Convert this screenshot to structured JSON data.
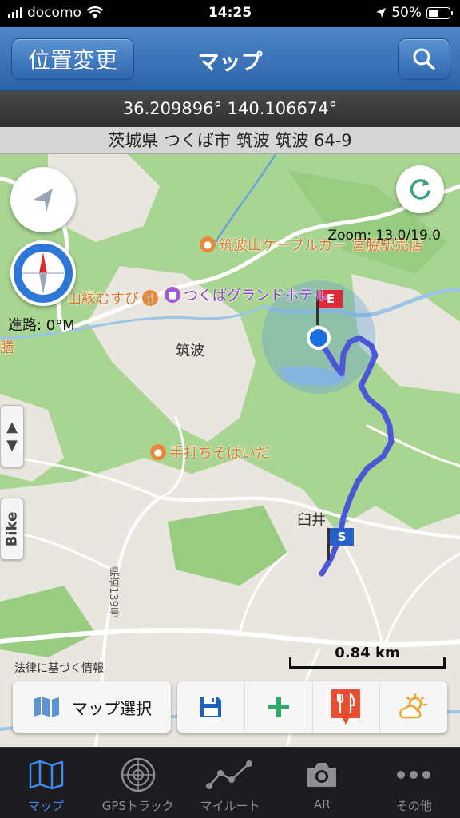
{
  "status_bar": {
    "carrier": "docomo",
    "time": "14:25",
    "battery": "50%",
    "battery_level": 0.5
  },
  "nav": {
    "left_button": "位置変更",
    "title": "マップ",
    "right_icon": "search-icon"
  },
  "location": {
    "coordinates": "36.209896° 140.106674°",
    "address": "茨城県 つくば市 筑波 筑波 64-9"
  },
  "map": {
    "zoom": "Zoom: 13.0/19.0",
    "heading": "進路: 0°M",
    "places": {
      "tsukuba": "筑波",
      "usui": "臼井",
      "route_number": "県道139号"
    },
    "pois": {
      "cable_car": "筑波山ケーブルカー 宮脇駅売店",
      "hotel": "つくばグランドホテル",
      "musubi": "山縁むすび",
      "soba": "手打ちそばいだ",
      "edge": "膳"
    },
    "markers": {
      "end": "E",
      "start": "S"
    },
    "side_tab": "Bike",
    "legal": "法律に基づく情報",
    "scale": "0.84 km"
  },
  "tools": {
    "map_select": "マップ選択"
  },
  "tabs": [
    {
      "label": "マップ",
      "icon": "map-icon",
      "active": true
    },
    {
      "label": "GPSトラック",
      "icon": "radar-icon",
      "active": false
    },
    {
      "label": "マイルート",
      "icon": "route-icon",
      "active": false
    },
    {
      "label": "AR",
      "icon": "camera-icon",
      "active": false
    },
    {
      "label": "その他",
      "icon": "more-icon",
      "active": false
    }
  ],
  "colors": {
    "accent": "#3f8cf0",
    "track": "#4b57d6",
    "nav": "#3a71b8",
    "map_green": "#a9d592"
  }
}
